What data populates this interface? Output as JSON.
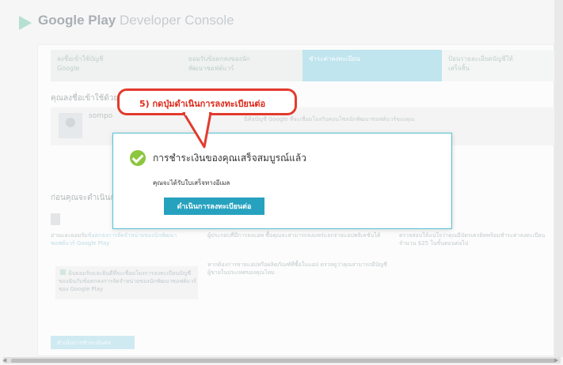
{
  "header": {
    "brand_bold": "Google Play",
    "brand_light": " Developer Console"
  },
  "steps": [
    {
      "label": "ลงชื่อเข้าใช้บัญชี",
      "label2": "Google"
    },
    {
      "label": "ยอมรับข้อตกลงของนัก",
      "label2": "พัฒนาซอฟต์แวร์"
    },
    {
      "label": "ชำระค่าลงทะเบียน",
      "label2": ""
    },
    {
      "label": "ป้อนรายละเอียดบัญชีให้",
      "label2": "เสร็จสิ้น"
    }
  ],
  "account": {
    "section_title": "คุณลงชื่อเข้าใช้ด้วย",
    "name": "sompo",
    "text": "นี่คือบัญชี Google ที่จะเชื่อมโยงกับคอนโซลนักพัฒนาซอฟต์แวร์ของคุณ"
  },
  "before": {
    "section_title": "ก่อนคุณจะดำเนินการ",
    "col1_text": "อ่านและยอมรับ",
    "col1_link": "ข้อตกลงการจัดจำหน่ายของนักพัฒนาซอฟต์แวร์ Google Play",
    "col2_text": "ผู้ประกอบที่มีการลงแอพ ซื้อคุณจะสามารถลงแพร่แจกจ่ายแอปพลิเคชันได้",
    "col2_text2": "หากต้องการขายแอปหรือผลิตภัณฑ์ที่ซื้อในแอป ตรวจดูว่าคุณสามารถมีบัญชีผู้ขายในประเทศของคุณไหม",
    "col3_text": "ตรวจสอบให้แน่ใจว่าคุณมีบัตรเครดิตพร้อมชำระค่าลงทะเบียนจำนวน $25 ในขั้นตอนต่อไป",
    "checkbox_text": "ฉันยอมรับและยินดีที่จะเชื่อมโยงการลงทะเบียนบัญชีของฉันกับข้อตกลงการจัดจำหน่ายของนักพัฒนาซอฟต์แวร์ของ Google Play",
    "pay_button": "ดำเนินการชำระเงินต่อ"
  },
  "dialog": {
    "title": "การชำระเงินของคุณเสร็จสมบูรณ์แล้ว",
    "subtitle": "คุณจะได้รับใบเสร็จทางอีเมล",
    "button": "ดำเนินการลงทะเบียนต่อ"
  },
  "callout": {
    "text": "5) กดปุ่มดำเนินการลงทะเบียนต่อ"
  },
  "colors": {
    "accent": "#26a2bf",
    "success": "#8dc63f",
    "callout_red": "#e23b2e"
  }
}
